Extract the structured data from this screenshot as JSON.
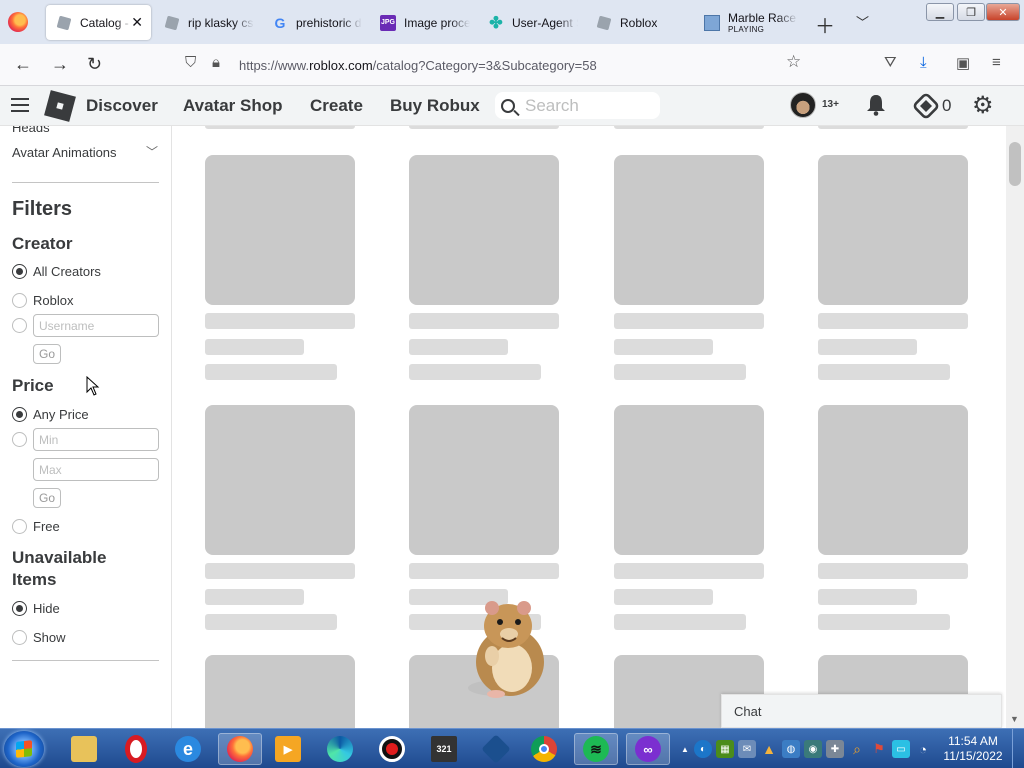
{
  "browser": {
    "tabs": [
      {
        "title": "Catalog - Roblox",
        "favicon": "roblox-tile-icon",
        "active": true
      },
      {
        "title": "rip klasky csupo",
        "favicon": "roblox-tile-icon"
      },
      {
        "title": "prehistoric dinosaur",
        "favicon": "google-icon"
      },
      {
        "title": "Image processing",
        "favicon": "jpg-icon"
      },
      {
        "title": "User-Agent Switcher",
        "favicon": "puzzle-icon"
      },
      {
        "title": "Roblox",
        "favicon": "roblox-tile-icon"
      },
      {
        "title": "Marble Race",
        "subtitle": "PLAYING",
        "favicon": "marble-icon"
      }
    ],
    "url_prefix": "https://www.",
    "url_domain": "roblox.com",
    "url_path": "/catalog?Category=3&Subcategory=58"
  },
  "header": {
    "nav": [
      "Discover",
      "Avatar Shop",
      "Create",
      "Buy Robux"
    ],
    "search_placeholder": "Search",
    "age_badge": "13+",
    "robux_count": "0"
  },
  "sidebar": {
    "cut_category": "Heads",
    "category": "Avatar Animations",
    "filters_title": "Filters",
    "creator": {
      "title": "Creator",
      "all": "All Creators",
      "roblox": "Roblox",
      "username_placeholder": "Username",
      "go": "Go"
    },
    "price": {
      "title": "Price",
      "any": "Any Price",
      "min_placeholder": "Min",
      "max_placeholder": "Max",
      "go": "Go",
      "free": "Free"
    },
    "unavailable": {
      "title_line1": "Unavailable",
      "title_line2": "Items",
      "hide": "Hide",
      "show": "Show"
    }
  },
  "chat": {
    "label": "Chat"
  },
  "taskbar": {
    "time": "11:54 AM",
    "date": "11/15/2022"
  }
}
